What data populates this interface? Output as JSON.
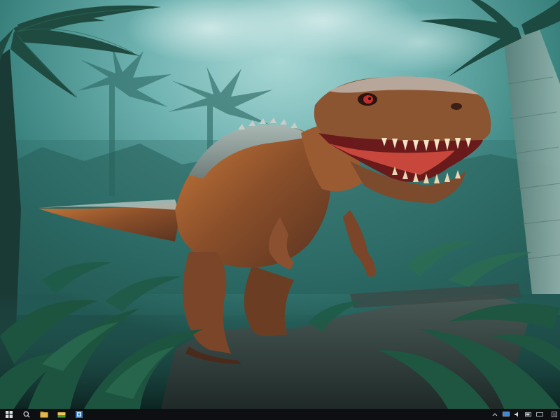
{
  "desktop": {
    "wallpaper": {
      "sky_color": "#7fbcbe",
      "mist_color": "#3f8a86",
      "jungle_color": "#12332f"
    }
  },
  "taskbar": {
    "background": "#0d0f12",
    "start_icon": "windows-start-icon",
    "pinned": [
      {
        "name": "search-icon"
      },
      {
        "name": "file-explorer-icon"
      },
      {
        "name": "folder-icon"
      },
      {
        "name": "store-icon"
      }
    ],
    "tray": [
      {
        "name": "chevron-up-icon"
      },
      {
        "name": "network-icon"
      },
      {
        "name": "volume-icon"
      },
      {
        "name": "battery-icon"
      },
      {
        "name": "keyboard-icon"
      }
    ],
    "clock": {
      "time": "",
      "date": ""
    }
  }
}
